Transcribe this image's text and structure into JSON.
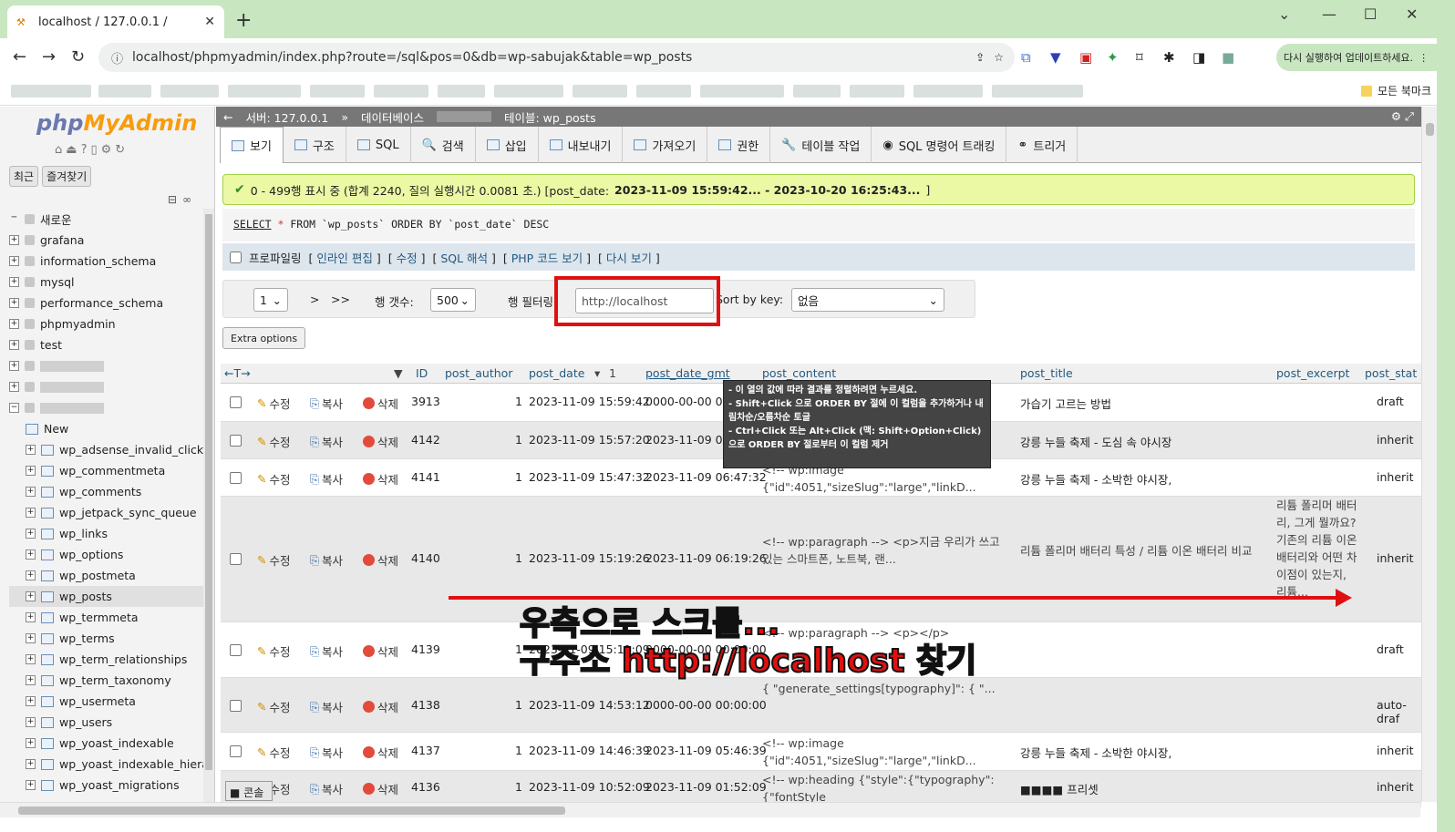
{
  "browser": {
    "tab_title": "localhost / 127.0.0.1 /",
    "url": "localhost/phpmyadmin/index.php?route=/sql&pos=0&db=wp-sabujak&table=wp_posts",
    "update_text": "다시 실행하여 업데이트하세요.",
    "all_bookmarks": "모든 북마크"
  },
  "pma": {
    "logo_php": "php",
    "logo_admin": "MyAdmin",
    "nav_tabs": [
      "최근",
      "즐겨찾기"
    ],
    "tree": [
      {
        "label": "새로운",
        "type": "new"
      },
      {
        "label": "grafana",
        "type": "db"
      },
      {
        "label": "information_schema",
        "type": "db"
      },
      {
        "label": "mysql",
        "type": "db"
      },
      {
        "label": "performance_schema",
        "type": "db"
      },
      {
        "label": "phpmyadmin",
        "type": "db"
      },
      {
        "label": "test",
        "type": "db"
      }
    ],
    "tables": [
      "New",
      "wp_adsense_invalid_click_p",
      "wp_commentmeta",
      "wp_comments",
      "wp_jetpack_sync_queue",
      "wp_links",
      "wp_options",
      "wp_postmeta",
      "wp_posts",
      "wp_termmeta",
      "wp_terms",
      "wp_term_relationships",
      "wp_term_taxonomy",
      "wp_usermeta",
      "wp_users",
      "wp_yoast_indexable",
      "wp_yoast_indexable_hierar",
      "wp_yoast_migrations"
    ],
    "breadcrumb": {
      "server": "서버: 127.0.0.1",
      "database": "데이터베이스",
      "table": "테이블: wp_posts"
    },
    "menu": [
      "보기",
      "구조",
      "SQL",
      "검색",
      "삽입",
      "내보내기",
      "가져오기",
      "권한",
      "테이블 작업",
      "SQL 명령어 트래킹",
      "트리거"
    ],
    "success_msg": "0 - 499행 표시 중 (합계 2240, 질의 실행시간 0.0081 초.) [post_date:",
    "success_range": "2023-11-09 15:59:42... - 2023-10-20 16:25:43...",
    "success_tail": "]",
    "sql": {
      "select": "SELECT",
      "star": "*",
      "rest": "FROM `wp_posts` ORDER BY `post_date` DESC"
    },
    "profiling": "프로파일링",
    "links": [
      "인라인 편집",
      "수정",
      "SQL 해석",
      "PHP 코드 보기",
      "다시 보기"
    ],
    "nav": {
      "page": "1",
      "next": ">",
      "last": ">>",
      "rows_label": "행 갯수:",
      "rows": "500",
      "filter_label": "행 필터링",
      "filter_value": "http://localhost",
      "sort_label": "Sort by key:",
      "sort_value": "없음"
    },
    "extra_options": "Extra options",
    "columns": {
      "id": "ID",
      "author": "post_author",
      "date": "post_date",
      "date_num": "1",
      "gmt": "post_date_gmt",
      "content": "post_content",
      "title": "post_title",
      "excerpt": "post_excerpt",
      "status": "post_stat"
    },
    "actions": {
      "edit": "수정",
      "copy": "복사",
      "delete": "삭제"
    },
    "rows": [
      {
        "id": "3913",
        "author": "1",
        "date": "2023-11-09 15:59:42",
        "gmt": "0000-00-00 00",
        "content": "",
        "title": "가습기 고르는 방법",
        "excerpt": "",
        "status": "draft"
      },
      {
        "id": "4142",
        "author": "1",
        "date": "2023-11-09 15:57:20",
        "gmt": "2023-11-09 06",
        "content": "",
        "title": "강릉 누들 축제 - 도심 속 야시장",
        "excerpt": "",
        "status": "inherit"
      },
      {
        "id": "4141",
        "author": "1",
        "date": "2023-11-09 15:47:32",
        "gmt": "2023-11-09 06:47:32",
        "content": "<!-- wp:image {\"id\":4051,\"sizeSlug\":\"large\",\"linkD...",
        "title": "강릉 누들 축제 - 소박한 야시장,",
        "excerpt": "",
        "status": "inherit"
      },
      {
        "id": "4140",
        "author": "1",
        "date": "2023-11-09 15:19:26",
        "gmt": "2023-11-09 06:19:26",
        "content": "<!-- wp:paragraph --> <p>지금 우리가 쓰고 있는 스마트폰, 노트북, 랜...",
        "title": "리튬 폴리머 배터리 특성 / 리튬 이온 배터리 비교",
        "excerpt": "리튬 폴리머 배터리, 그게 뭘까요? 기존의 리튬 이온 배터리와 어떤 차이점이 있는지, 리튬...",
        "status": "inherit"
      },
      {
        "id": "4139",
        "author": "1",
        "date": "2023-11-09 15:11:09",
        "gmt": "0000-00-00 00:00:00",
        "content": "<!-- wp:paragraph --> <p></p>",
        "title": "",
        "excerpt": "",
        "status": "draft"
      },
      {
        "id": "4138",
        "author": "1",
        "date": "2023-11-09 14:53:12",
        "gmt": "0000-00-00 00:00:00",
        "content": "{ \"generate_settings[typography]\": { \"...",
        "title": "",
        "excerpt": "",
        "status": "auto-draf"
      },
      {
        "id": "4137",
        "author": "1",
        "date": "2023-11-09 14:46:39",
        "gmt": "2023-11-09 05:46:39",
        "content": "<!-- wp:image {\"id\":4051,\"sizeSlug\":\"large\",\"linkD...",
        "title": "강릉 누들 축제 - 소박한 야시장,",
        "excerpt": "",
        "status": "inherit"
      },
      {
        "id": "4136",
        "author": "1",
        "date": "2023-11-09 10:52:09",
        "gmt": "2023-11-09 01:52:09",
        "content": "<!-- wp:heading {\"style\":{\"typography\": {\"fontStyle",
        "title": "■■■■ 프리셋",
        "excerpt": "",
        "status": "inherit"
      }
    ],
    "tooltip": [
      "- 이 열의 값에 따라 결과를 정렬하려면 누르세요.",
      "- Shift+Click 으로 ORDER BY 절에 이 컬럼을 추가하거나 내림차순/오름차순 토글",
      "- Ctrl+Click 또는 Alt+Click (맥: Shift+Option+Click) 으로 ORDER BY 절로부터 이 컬럼 제거"
    ],
    "console": "콘솔"
  },
  "annotation": {
    "line1": "우측으로 스크롤...",
    "line2": "구주소 http://localhost 찾기"
  }
}
